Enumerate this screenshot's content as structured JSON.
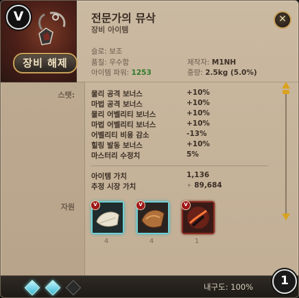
{
  "item": {
    "grade_badge": "V",
    "unequip_label": "장비 해제",
    "title": "전문가의 뮤삭",
    "subtitle": "장비 아이템",
    "slot_label": "슬로: 보조",
    "quality_label": "품질: 우수함",
    "power_label": "아이템 파워:",
    "power_value": "1253",
    "maker_label": "제작자:",
    "maker_value": "M1NH",
    "weight_label": "중량:",
    "weight_value": "2.5kg (5.0%)",
    "close_label": "✕"
  },
  "stats": {
    "section_label": "스탯:",
    "rows": [
      {
        "name": "물리 공격 보너스",
        "value": "+10%"
      },
      {
        "name": "마법 공격 보너스",
        "value": "+10%"
      },
      {
        "name": "물리 어벨리티 보너스",
        "value": "+10%"
      },
      {
        "name": "마법 어벨리티 보너스",
        "value": "+10%"
      },
      {
        "name": "어벨리티 비용 감소",
        "value": "-13%"
      },
      {
        "name": "힐링 발동 보너스",
        "value": "+10%"
      },
      {
        "name": "마스터리 수정치",
        "value": "5%"
      }
    ]
  },
  "value": {
    "item_value_label": "아이템 가치",
    "item_value": "1,136",
    "market_label": "추정 시장 가치",
    "market_value": "89,684"
  },
  "resources": {
    "section_label": "자원",
    "items": [
      {
        "icon": "cloth-material-icon",
        "count": "4",
        "badge": "V"
      },
      {
        "icon": "leather-material-icon",
        "count": "4",
        "badge": "V"
      },
      {
        "icon": "artifact-item-icon",
        "count": "1",
        "badge": "V"
      }
    ]
  },
  "footer": {
    "durability": "내구도: 100%",
    "stack_count": "1",
    "gems": [
      "on",
      "on",
      "off"
    ]
  },
  "colors": {
    "accent_gold": "#d9a21f",
    "power_green": "#2f7a2a",
    "gem_cyan": "#3bb6d2"
  }
}
